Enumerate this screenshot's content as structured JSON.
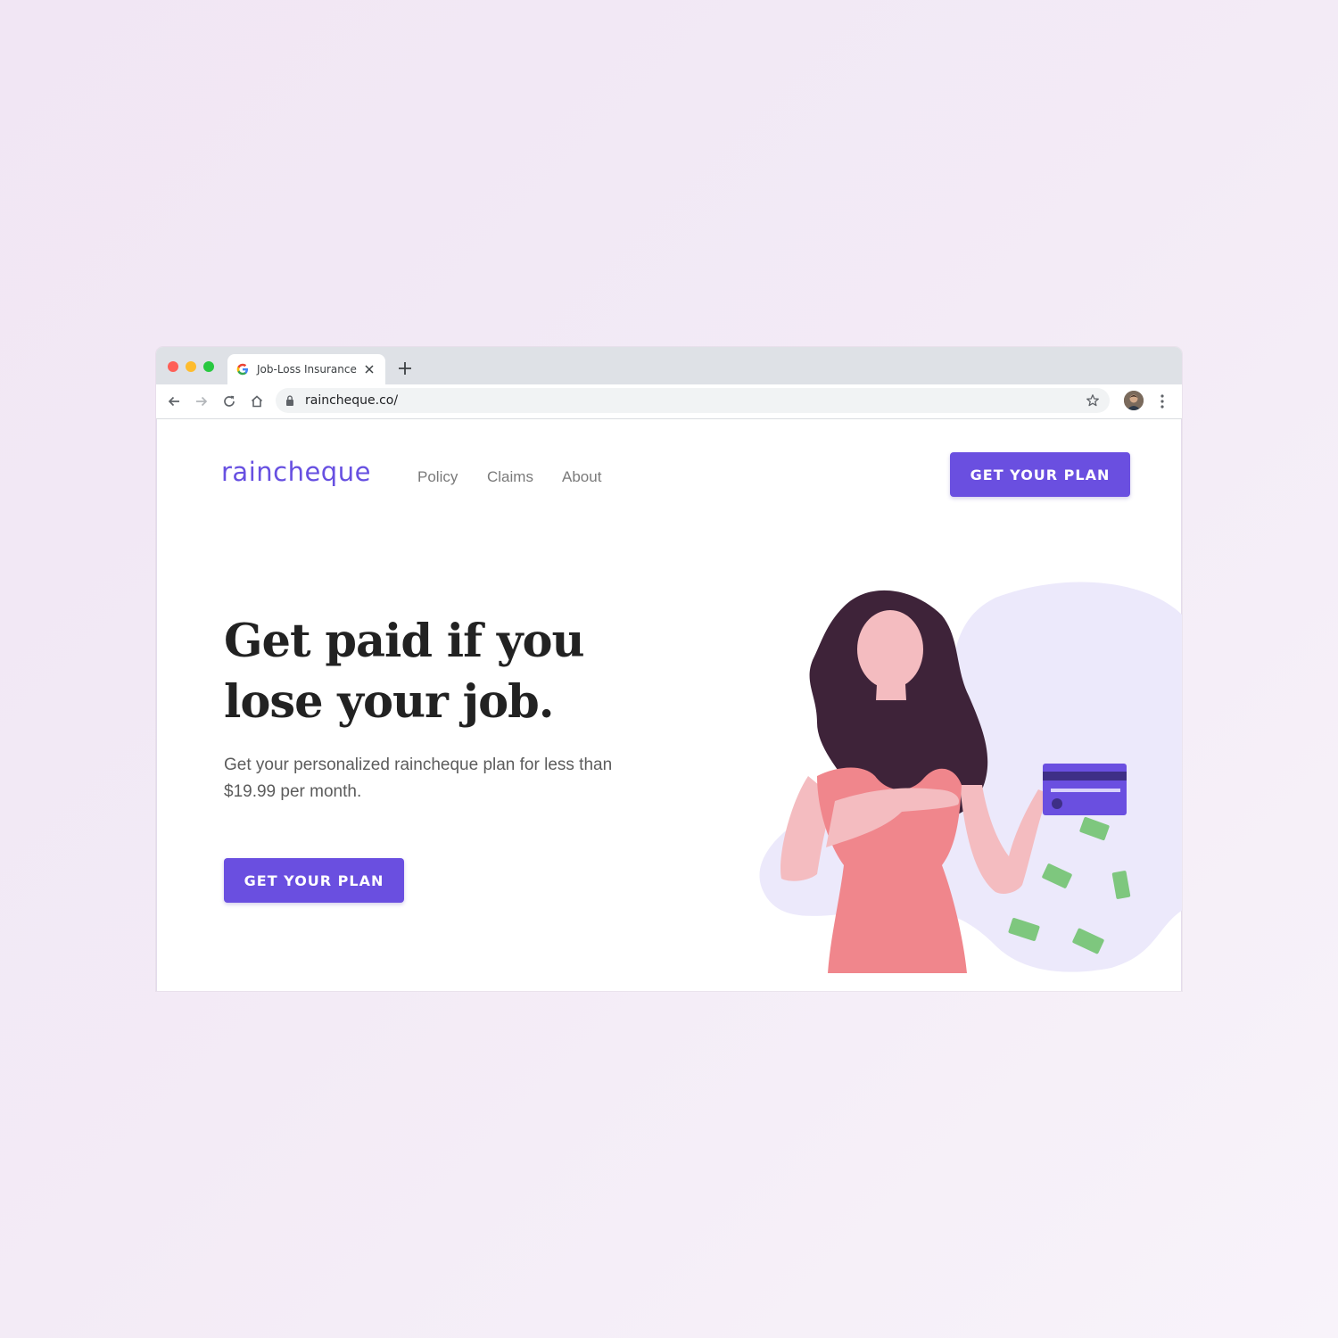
{
  "browser": {
    "tab_title": "Job-Loss Insurance",
    "url": "raincheque.co/"
  },
  "site": {
    "logo": "raincheque",
    "nav": [
      "Policy",
      "Claims",
      "About"
    ],
    "header_cta": "GET YOUR PLAN"
  },
  "hero": {
    "headline": "Get paid if you lose your job.",
    "subtext": "Get your personalized raincheque plan for less than $19.99 per month.",
    "cta": "GET YOUR PLAN"
  },
  "colors": {
    "brand": "#6a4fe0",
    "blob": "#ece9fb",
    "dress": "#f0868c",
    "skin": "#f4bcc0",
    "hair": "#3e2339",
    "bill": "#7ec77e"
  },
  "icons": [
    "google-icon",
    "close-icon",
    "plus-icon",
    "back-icon",
    "forward-icon",
    "reload-icon",
    "home-icon",
    "lock-icon",
    "star-icon",
    "kebab-icon"
  ]
}
